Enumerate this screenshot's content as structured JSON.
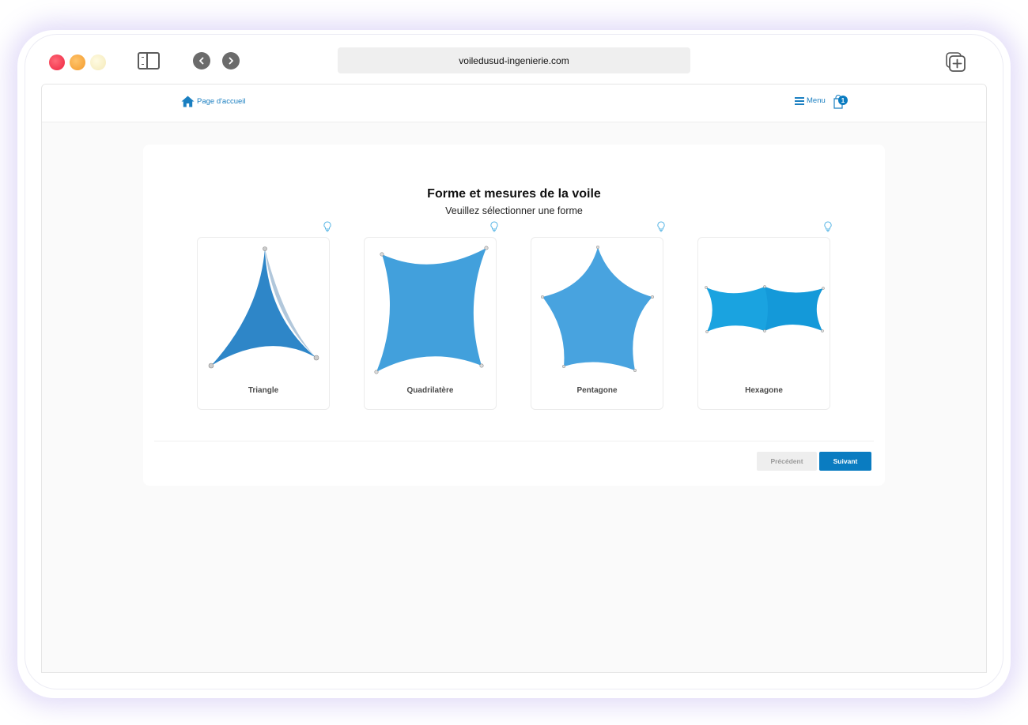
{
  "browser": {
    "url": "voiledusud-ingenierie.com",
    "icons": [
      "sidebar-toggle-icon",
      "chevron-left-icon",
      "chevron-right-icon",
      "new-tab-icon"
    ]
  },
  "site_nav": {
    "home_label": "Page d'accueil",
    "menu_label": "Menu",
    "cart_count": "1"
  },
  "page": {
    "title": "Forme et mesures de la voile",
    "subtitle": "Veuillez sélectionner une forme"
  },
  "shapes": [
    {
      "label": "Triangle",
      "color": "#2e86c8"
    },
    {
      "label": "Quadrilatère",
      "color": "#42a0dc"
    },
    {
      "label": "Pentagone",
      "color": "#48a3df"
    },
    {
      "label": "Hexagone",
      "color": "#1aa3e0"
    }
  ],
  "actions": {
    "prev_label": "Précédent",
    "next_label": "Suivant"
  },
  "colors": {
    "accent": "#0a7cc1",
    "link": "#1a7fc1",
    "hint_icon": "#5bb7e6"
  }
}
